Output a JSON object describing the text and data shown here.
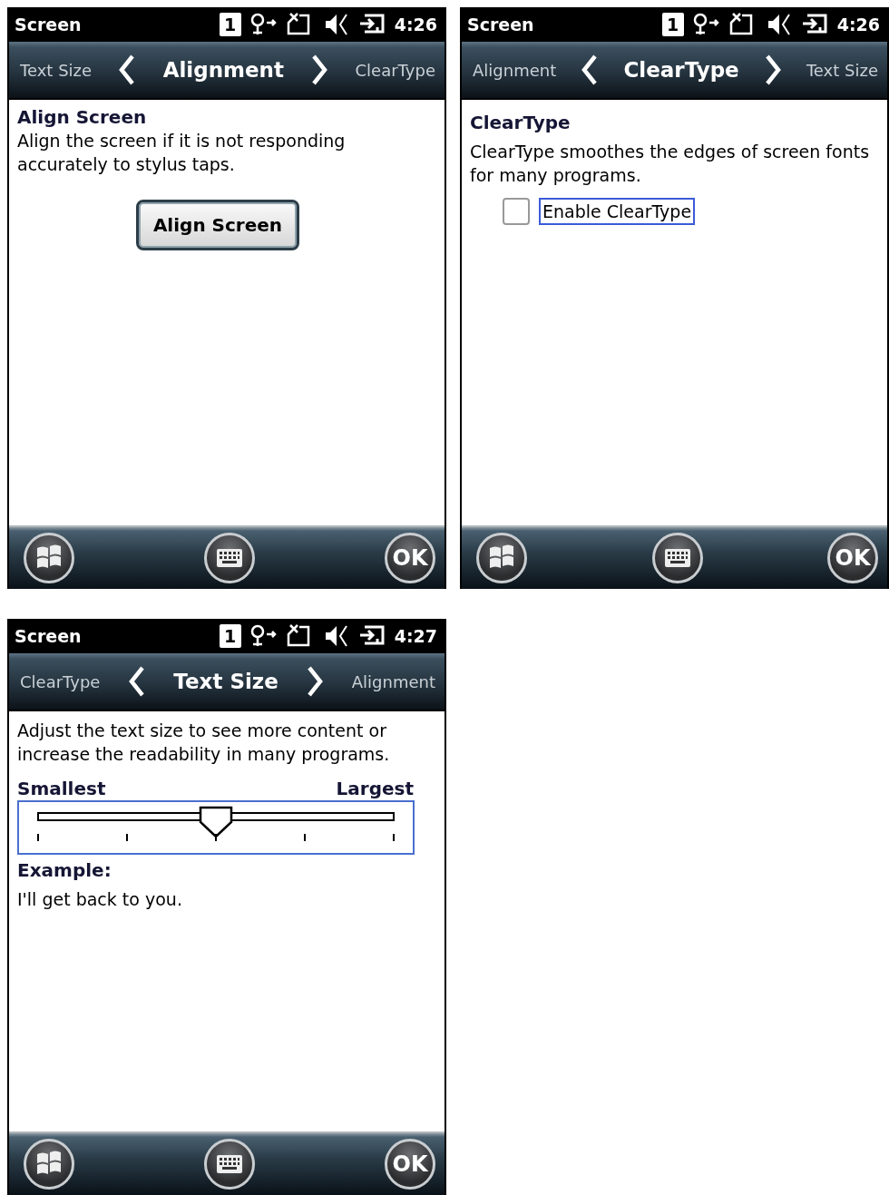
{
  "screens": [
    {
      "status": {
        "title": "Screen",
        "notification": "1",
        "time": "4:26"
      },
      "tabs": [
        {
          "label": "Text Size",
          "selected": false
        },
        {
          "label": "Alignment",
          "selected": true
        },
        {
          "label": "ClearType",
          "selected": false
        }
      ],
      "content": {
        "kind": "alignment",
        "heading": "Align Screen",
        "description": "Align the screen if it is not responding accurately to stylus taps.",
        "button": "Align Screen"
      },
      "softkeys": {
        "ok": "OK"
      }
    },
    {
      "status": {
        "title": "Screen",
        "notification": "1",
        "time": "4:26"
      },
      "tabs": [
        {
          "label": "Alignment",
          "selected": false
        },
        {
          "label": "ClearType",
          "selected": true
        },
        {
          "label": "Text Size",
          "selected": false
        }
      ],
      "content": {
        "kind": "cleartype",
        "heading": "ClearType",
        "description": "ClearType smoothes the edges of screen fonts for many programs.",
        "checkbox": {
          "label": "Enable ClearType",
          "checked": false
        }
      },
      "softkeys": {
        "ok": "OK"
      }
    },
    {
      "status": {
        "title": "Screen",
        "notification": "1",
        "time": "4:27"
      },
      "tabs": [
        {
          "label": "ClearType",
          "selected": false
        },
        {
          "label": "Text Size",
          "selected": true
        },
        {
          "label": "Alignment",
          "selected": false
        }
      ],
      "content": {
        "kind": "textsize",
        "description": "Adjust the text size to see more content or increase the readability in many programs.",
        "slider": {
          "min_label": "Smallest",
          "max_label": "Largest",
          "level": 0.5
        },
        "example_label": "Example:",
        "example_text": "I'll get back to you."
      },
      "softkeys": {
        "ok": "OK"
      }
    }
  ]
}
